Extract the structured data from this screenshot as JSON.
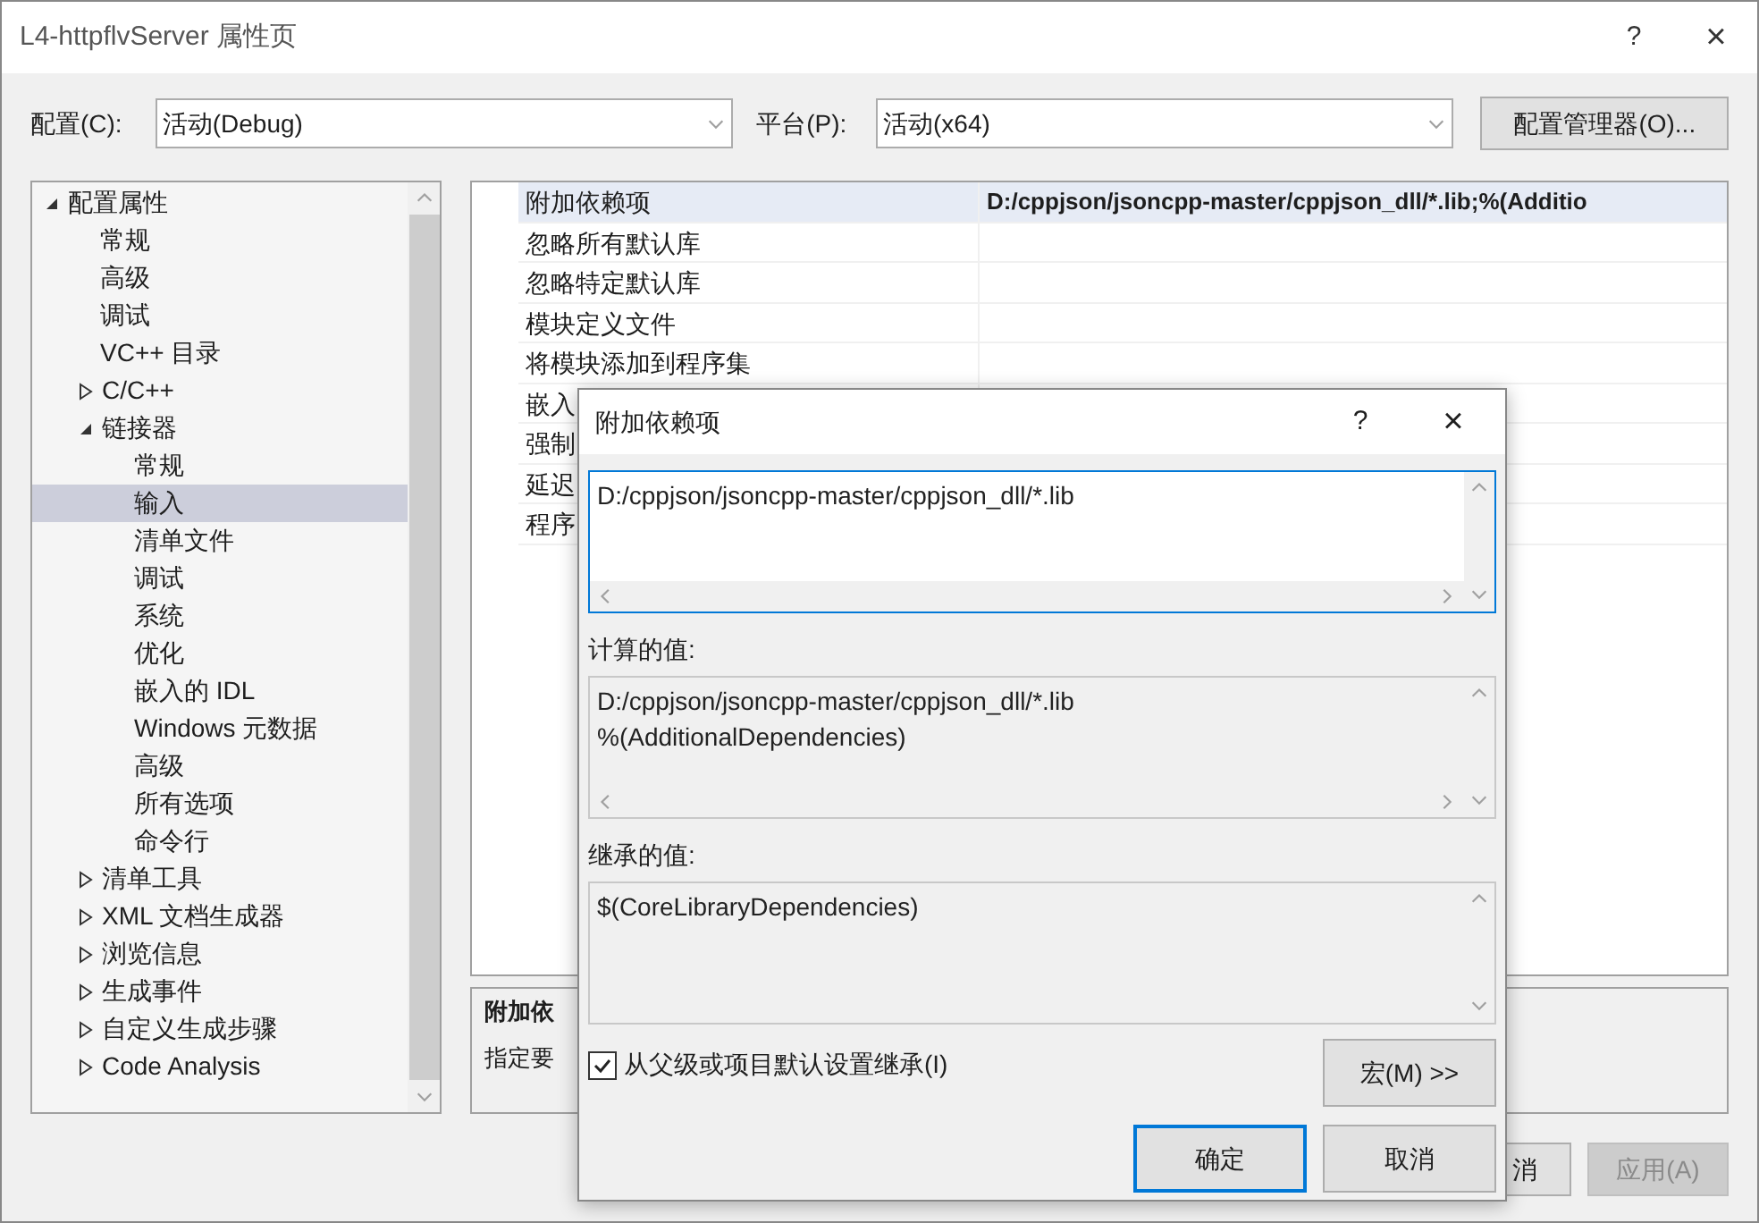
{
  "window": {
    "title": "L4-httpflvServer 属性页",
    "help": "?",
    "close": "×"
  },
  "config_bar": {
    "config_label": "配置(C):",
    "config_value": "活动(Debug)",
    "platform_label": "平台(P):",
    "platform_value": "活动(x64)",
    "manager_button": "配置管理器(O)..."
  },
  "tree": [
    {
      "label": "配置属性",
      "expanded": true,
      "selected": false,
      "children": [
        {
          "label": "常规",
          "selected": false
        },
        {
          "label": "高级",
          "selected": false
        },
        {
          "label": "调试",
          "selected": false
        },
        {
          "label": "VC++ 目录",
          "selected": false
        },
        {
          "label": "C/C++",
          "expanded": false,
          "selected": false
        },
        {
          "label": "链接器",
          "expanded": true,
          "selected": false,
          "children": [
            {
              "label": "常规",
              "selected": false
            },
            {
              "label": "输入",
              "selected": true
            },
            {
              "label": "清单文件",
              "selected": false
            },
            {
              "label": "调试",
              "selected": false
            },
            {
              "label": "系统",
              "selected": false
            },
            {
              "label": "优化",
              "selected": false
            },
            {
              "label": "嵌入的 IDL",
              "selected": false
            },
            {
              "label": "Windows 元数据",
              "selected": false
            },
            {
              "label": "高级",
              "selected": false
            },
            {
              "label": "所有选项",
              "selected": false
            },
            {
              "label": "命令行",
              "selected": false
            }
          ]
        },
        {
          "label": "清单工具",
          "expanded": false,
          "selected": false
        },
        {
          "label": "XML 文档生成器",
          "expanded": false,
          "selected": false
        },
        {
          "label": "浏览信息",
          "expanded": false,
          "selected": false
        },
        {
          "label": "生成事件",
          "expanded": false,
          "selected": false
        },
        {
          "label": "自定义生成步骤",
          "expanded": false,
          "selected": false
        },
        {
          "label": "Code Analysis",
          "expanded": false,
          "selected": false
        }
      ]
    }
  ],
  "properties": [
    {
      "name": "附加依赖项",
      "value": "D:/cppjson/jsoncpp-master/cppjson_dll/*.lib;%(Additio",
      "selected": true
    },
    {
      "name": "忽略所有默认库",
      "selected": false
    },
    {
      "name": "忽略特定默认库",
      "selected": false
    },
    {
      "name": "模块定义文件",
      "selected": false
    },
    {
      "name": "将模块添加到程序集",
      "selected": false
    },
    {
      "name": "嵌入",
      "selected": false
    },
    {
      "name": "强制",
      "selected": false
    },
    {
      "name": "延迟",
      "selected": false
    },
    {
      "name": "程序",
      "selected": false
    }
  ],
  "description": {
    "title": "附加依",
    "text": "指定要"
  },
  "buttons": [
    {
      "label": "消",
      "disabled": false
    },
    {
      "label": "应用(A)",
      "disabled": true
    }
  ],
  "dialog": {
    "title": "附加依赖项",
    "help": "?",
    "close": "×",
    "value": "D:/cppjson/jsoncpp-master/cppjson_dll/*.lib",
    "evaluated_label": "计算的值:",
    "evaluated_lines": [
      "D:/cppjson/jsoncpp-master/cppjson_dll/*.lib",
      "%(AdditionalDependencies)"
    ],
    "inherited_label": "继承的值:",
    "inherited_lines": [
      "$(CoreLibraryDependencies)"
    ],
    "inherit_checkbox": {
      "label": "从父级或项目默认设置继承(I)",
      "checked": true
    },
    "macros_button": "宏(M) >>",
    "ok_button": "确定",
    "cancel_button": "取消"
  }
}
